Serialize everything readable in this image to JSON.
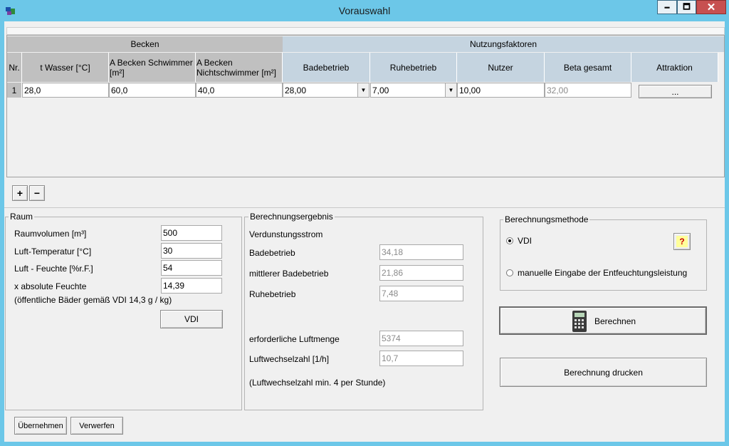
{
  "window": {
    "title": "Vorauswahl",
    "min_glyph": "🗕",
    "max_glyph": "🗖",
    "close_glyph": "✕"
  },
  "grid": {
    "group_becken": "Becken",
    "group_nutzung": "Nutzungsfaktoren",
    "columns": [
      "Nr.",
      "t Wasser [°C]",
      "A Becken Schwimmer [m²]",
      "A Becken Nichtschwimmer [m²]",
      "Badebetrieb",
      "Ruhebetrieb",
      "Nutzer",
      "Beta gesamt",
      "Attraktion"
    ],
    "row": {
      "nr": "1",
      "t_wasser": "28,0",
      "a_schwimmer": "60,0",
      "a_nichtschwimmer": "40,0",
      "badebetrieb": "28,00",
      "ruhebetrieb": "7,00",
      "nutzer": "10,00",
      "beta_gesamt": "32,00",
      "attraktion_btn": "..."
    },
    "add_glyph": "+",
    "remove_glyph": "−"
  },
  "raum": {
    "title": "Raum",
    "raumvolumen_label": "Raumvolumen [m³]",
    "raumvolumen": "500",
    "temp_label": "Luft-Temperatur [°C]",
    "temp": "30",
    "feuchte_label": "Luft - Feuchte [%r.F.]",
    "feuchte": "54",
    "xabs_label": "x absolute Feuchte",
    "xabs": "14,39",
    "note": "(öffentliche Bäder gemäß VDI 14,3 g / kg)",
    "vdi_button": "VDI"
  },
  "ergebnis": {
    "title": "Berechnungsergebnis",
    "verdunstung_label": "Verdunstungsstrom",
    "bade_label": "Badebetrieb",
    "bade": "34,18",
    "mittel_label": "mittlerer Badebetrieb",
    "mittel": "21,86",
    "ruhe_label": "Ruhebetrieb",
    "ruhe": "7,48",
    "luftmenge_label": "erforderliche Luftmenge",
    "luftmenge": "5374",
    "wechsel_label": "Luftwechselzahl [1/h]",
    "wechsel": "10,7",
    "note": "(Luftwechselzahl min. 4 per Stunde)"
  },
  "methode": {
    "title": "Berechnungsmethode",
    "opt_vdi": "VDI",
    "opt_manual": "manuelle Eingabe der Entfeuchtungsleistung",
    "help_glyph": "?",
    "selected": "VDI"
  },
  "actions": {
    "berechnen": "Berechnen",
    "drucken": "Berechnung drucken",
    "uebernehmen": "Übernehmen",
    "verwerfen": "Verwerfen"
  },
  "colors": {
    "frame": "#6cc7e8",
    "header_blue": "#c5d4e0",
    "header_gray": "#c0c0c0",
    "help_bg": "#ffff99",
    "help_fg": "#cc0000"
  }
}
